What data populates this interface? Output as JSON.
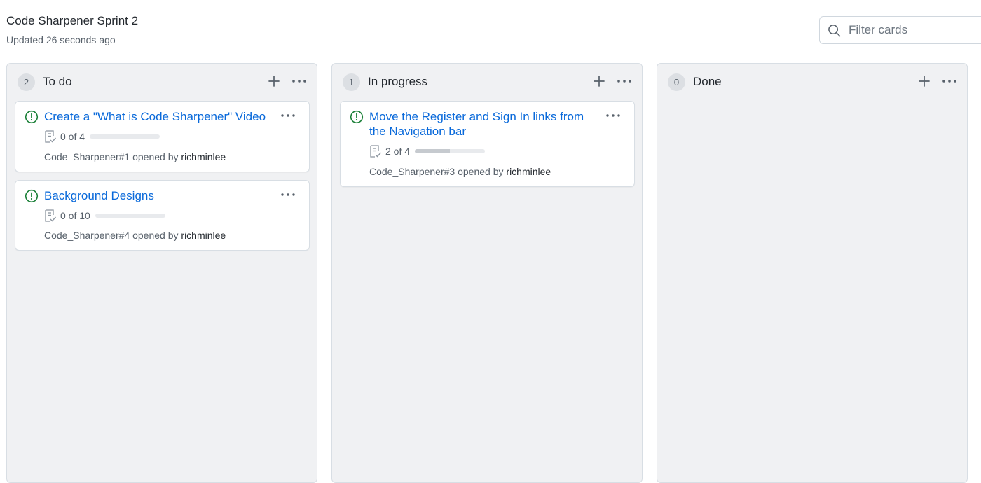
{
  "header": {
    "title": "Code Sharpener Sprint 2",
    "updated": "Updated 26 seconds ago"
  },
  "filter": {
    "placeholder": "Filter cards",
    "icon": "search-icon"
  },
  "colors": {
    "link": "#0969da",
    "open_issue": "#1a7f37",
    "column_bg": "#f0f1f3"
  },
  "columns": [
    {
      "name": "To do",
      "count": "2",
      "cards": [
        {
          "title": "Create a \"What is Code Sharpener\" Video",
          "tasks": "0 of 4",
          "progress": 0.0,
          "ref": "Code_Sharpener#1",
          "opened_by_text": "opened by",
          "user": "richminlee"
        },
        {
          "title": "Background Designs",
          "tasks": "0 of 10",
          "progress": 0.0,
          "ref": "Code_Sharpener#4",
          "opened_by_text": "opened by",
          "user": "richminlee"
        }
      ]
    },
    {
      "name": "In progress",
      "count": "1",
      "cards": [
        {
          "title": "Move the Register and Sign In links from the Navigation bar",
          "tasks": "2 of 4",
          "progress": 0.5,
          "ref": "Code_Sharpener#3",
          "opened_by_text": "opened by",
          "user": "richminlee"
        }
      ]
    },
    {
      "name": "Done",
      "count": "0",
      "cards": []
    }
  ]
}
